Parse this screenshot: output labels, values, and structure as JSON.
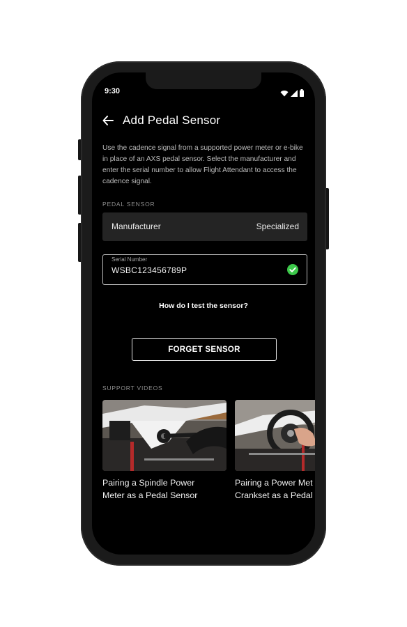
{
  "status_bar": {
    "time": "9:30",
    "icons": [
      "wifi-icon",
      "signal-icon",
      "battery-icon"
    ]
  },
  "header": {
    "back_icon": "arrow-left-icon",
    "title": "Add Pedal Sensor"
  },
  "description": "Use the cadence signal from a supported power meter or e-bike in place of an AXS pedal sensor. Select the manufacturer and enter the serial number to allow Flight Attendant to access the cadence signal.",
  "pedal_sensor": {
    "section_label": "PEDAL SENSOR",
    "manufacturer_label": "Manufacturer",
    "manufacturer_value": "Specialized",
    "serial_label": "Serial Number",
    "serial_value": "WSBC123456789P",
    "serial_status_icon": "check-circle-icon"
  },
  "help_link": "How do I test the sensor?",
  "forget_button": "FORGET SENSOR",
  "support_videos": {
    "section_label": "SUPPORT VIDEOS",
    "items": [
      {
        "title": "Pairing a Spindle Power\nMeter as a Pedal Sensor"
      },
      {
        "title": "Pairing a Power Met\nCrankset as a Pedal"
      }
    ]
  },
  "colors": {
    "background": "#000000",
    "phone_frame": "#1b1b1b",
    "row_background": "#242424",
    "success_green": "#3cc84a",
    "text_primary": "#ffffff",
    "text_secondary": "#bdbdbd"
  }
}
